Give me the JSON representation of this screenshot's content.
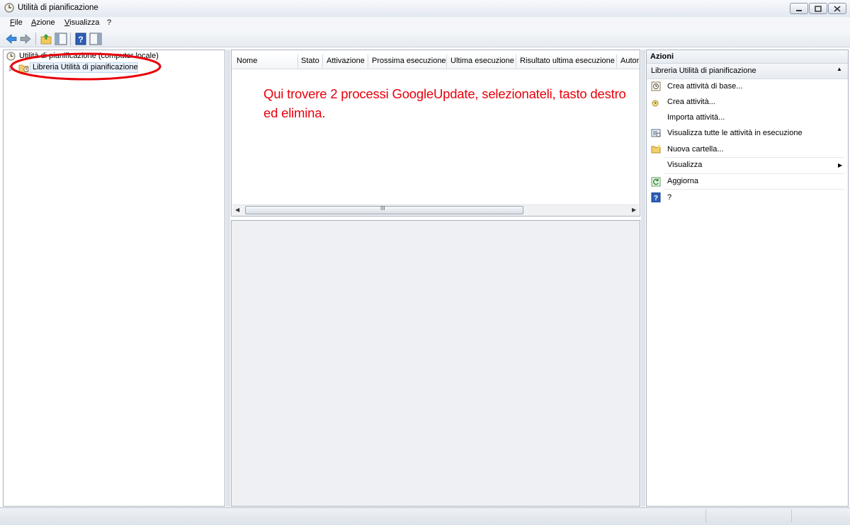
{
  "window": {
    "title": "Utilità di pianificazione"
  },
  "menu": [
    "File",
    "Azione",
    "Visualizza",
    "?"
  ],
  "toolbar": {
    "icons": [
      "back-icon",
      "forward-icon",
      "up-folder-icon",
      "show-hide-tree-icon",
      "help-icon",
      "show-hide-action-pane-icon"
    ]
  },
  "tree": {
    "root_label": "Utilità di pianificazione (computer locale)",
    "child_label": "Libreria Utilità di pianificazione"
  },
  "columns": [
    "Nome",
    "Stato",
    "Attivazione",
    "Prossima esecuzione",
    "Ultima esecuzione",
    "Risultato ultima esecuzione",
    "Autor"
  ],
  "annotation": {
    "text": "Qui trovere 2 processi GoogleUpdate, selezionateli, tasto destro ed elimina.",
    "color": "#e8000b"
  },
  "scrollbar": {
    "grip": "III"
  },
  "actions": {
    "title": "Azioni",
    "section": "Libreria Utilità di pianificazione",
    "items": [
      {
        "label": "Crea attività di base...",
        "icon": "create-basic-task-icon"
      },
      {
        "label": "Crea attività...",
        "icon": "create-task-icon"
      },
      {
        "label": "Importa attività...",
        "icon": ""
      },
      {
        "label": "Visualizza tutte le attività in esecuzione",
        "icon": "running-tasks-icon"
      },
      {
        "label": "Nuova cartella...",
        "icon": "new-folder-icon"
      },
      {
        "label": "Visualizza",
        "icon": "",
        "submenu": true
      },
      {
        "label": "Aggiorna",
        "icon": "refresh-icon"
      },
      {
        "label": "?",
        "icon": "help-icon"
      }
    ]
  }
}
